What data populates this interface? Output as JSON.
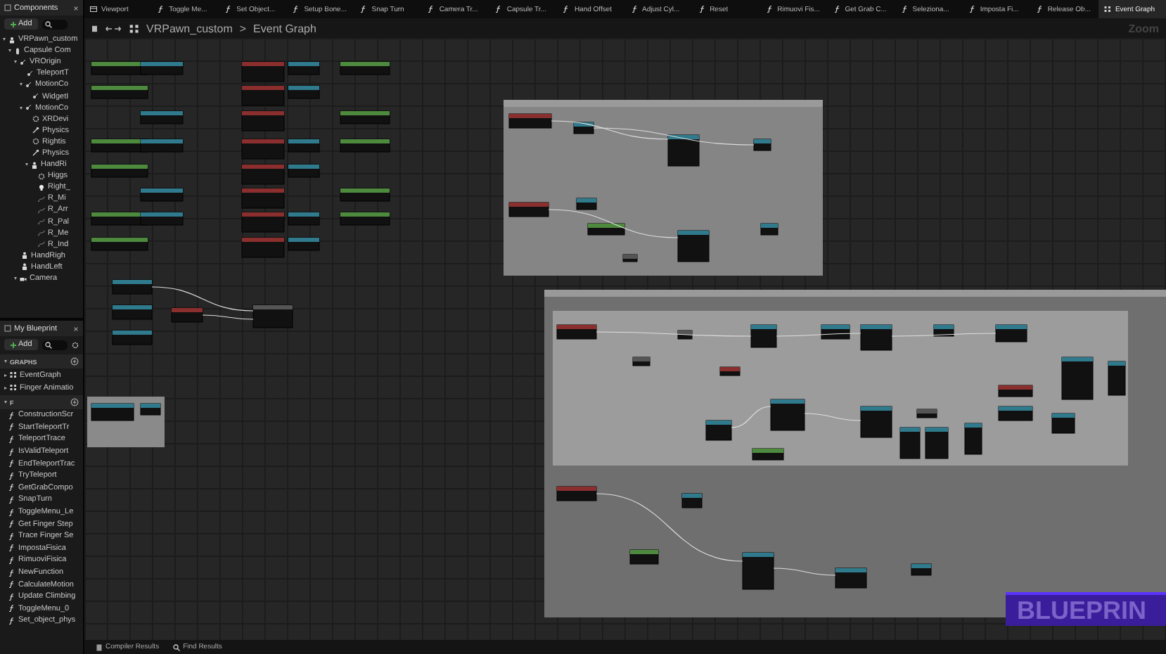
{
  "components_panel": {
    "title": "Components",
    "add_button": "Add",
    "tree": [
      {
        "label": "VRPawn_custom",
        "kind": "pawn",
        "expanded": true,
        "children": [
          {
            "label": "Capsule Com",
            "kind": "capsule",
            "expanded": true,
            "children": [
              {
                "label": "VROrigin",
                "kind": "scene",
                "expanded": true,
                "children": [
                  {
                    "label": "TeleportT",
                    "kind": "scene"
                  },
                  {
                    "label": "MotionCo",
                    "kind": "scene",
                    "expanded": true,
                    "children": [
                      {
                        "label": "WidgetI",
                        "kind": "scene"
                      }
                    ]
                  },
                  {
                    "label": "MotionCo",
                    "kind": "scene",
                    "expanded": true,
                    "children": [
                      {
                        "label": "XRDevi",
                        "kind": "device"
                      },
                      {
                        "label": "Physics",
                        "kind": "physics"
                      },
                      {
                        "label": "Rightis",
                        "kind": "device"
                      },
                      {
                        "label": "Physics",
                        "kind": "physics"
                      },
                      {
                        "label": "HandRi",
                        "kind": "mesh",
                        "expanded": true,
                        "children": [
                          {
                            "label": "Higgs",
                            "kind": "device"
                          },
                          {
                            "label": "Right_",
                            "kind": "light"
                          },
                          {
                            "label": "R_Mi",
                            "kind": "spline"
                          },
                          {
                            "label": "R_Arr",
                            "kind": "spline"
                          },
                          {
                            "label": "R_Pal",
                            "kind": "spline"
                          },
                          {
                            "label": "R_Me",
                            "kind": "spline"
                          },
                          {
                            "label": "R_Ind",
                            "kind": "spline"
                          }
                        ]
                      }
                    ]
                  }
                ]
              },
              {
                "label": "HandRigh",
                "kind": "mesh"
              },
              {
                "label": "HandLeft",
                "kind": "mesh"
              },
              {
                "label": "Camera",
                "kind": "camera",
                "expanded": true
              }
            ]
          }
        ]
      }
    ]
  },
  "my_blueprint_panel": {
    "title": "My Blueprint",
    "add_button": "Add",
    "sections": [
      {
        "title": "GRAPHS",
        "expanded": true,
        "items": [
          {
            "label": "EventGraph",
            "kind": "graph"
          },
          {
            "label": "Finger Animatio",
            "kind": "graph"
          }
        ]
      },
      {
        "title": "F",
        "expanded": true,
        "items": [
          {
            "label": "ConstructionScr",
            "kind": "function"
          },
          {
            "label": "StartTeleportTr",
            "kind": "function"
          },
          {
            "label": "TeleportTrace",
            "kind": "function"
          },
          {
            "label": "IsValidTeleport",
            "kind": "function"
          },
          {
            "label": "EndTeleportTrac",
            "kind": "function"
          },
          {
            "label": "TryTeleport",
            "kind": "function"
          },
          {
            "label": "GetGrabCompo",
            "kind": "function"
          },
          {
            "label": "SnapTurn",
            "kind": "function"
          },
          {
            "label": "ToggleMenu_Le",
            "kind": "function"
          },
          {
            "label": "Get Finger Step",
            "kind": "function"
          },
          {
            "label": "Trace Finger Se",
            "kind": "function"
          },
          {
            "label": "ImpostaFisica",
            "kind": "function"
          },
          {
            "label": "RimuoviFisica",
            "kind": "function"
          },
          {
            "label": "NewFunction",
            "kind": "function"
          },
          {
            "label": "CalculateMotion",
            "kind": "function"
          },
          {
            "label": "Update Climbing",
            "kind": "function"
          },
          {
            "label": "ToggleMenu_0",
            "kind": "function"
          },
          {
            "label": "Set_object_phys",
            "kind": "function"
          }
        ]
      }
    ]
  },
  "tabs": [
    {
      "label": "Viewport",
      "kind": "viewport",
      "selected": false
    },
    {
      "label": "Toggle Me...",
      "kind": "function",
      "selected": false
    },
    {
      "label": "Set Object...",
      "kind": "function",
      "selected": false
    },
    {
      "label": "Setup Bone...",
      "kind": "function",
      "selected": false
    },
    {
      "label": "Snap Turn",
      "kind": "function",
      "selected": false
    },
    {
      "label": "Camera Tr...",
      "kind": "function",
      "selected": false
    },
    {
      "label": "Capsule Tr...",
      "kind": "function",
      "selected": false
    },
    {
      "label": "Hand Offset",
      "kind": "function",
      "selected": false
    },
    {
      "label": "Adjust Cyl...",
      "kind": "function",
      "selected": false
    },
    {
      "label": "Reset",
      "kind": "function",
      "selected": false
    },
    {
      "label": "Rimuovi Fis...",
      "kind": "function",
      "selected": false
    },
    {
      "label": "Get Grab C...",
      "kind": "function",
      "selected": false
    },
    {
      "label": "Seleziona...",
      "kind": "function",
      "selected": false
    },
    {
      "label": "Imposta Fi...",
      "kind": "function",
      "selected": false
    },
    {
      "label": "Release Ob...",
      "kind": "function",
      "selected": false
    },
    {
      "label": "Event Graph",
      "kind": "graph",
      "selected": true
    }
  ],
  "breadcrumb": {
    "blueprint": "VRPawn_custom",
    "separator": ">",
    "graph": "Event Graph"
  },
  "zoom_label": "Zoom",
  "graph_type_label": "BLUEPRIN",
  "bottom_tabs": [
    {
      "label": "Compiler Results",
      "kind": "compiler"
    },
    {
      "label": "Find Results",
      "kind": "find"
    }
  ]
}
